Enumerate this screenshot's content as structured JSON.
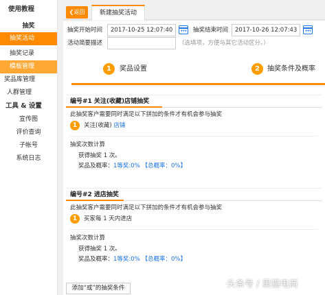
{
  "sidebar": {
    "group1": "使用教程",
    "sub1": "抽奖",
    "item_active": "抽奖活动",
    "item_record": "抽奖记录",
    "item_template": "模板管理",
    "item_prize_lib": "奖品库管理",
    "item_crowd": "人群管理",
    "group2": "工具 & 设置",
    "tools": [
      "宣传图",
      "评价查询",
      "子帐号",
      "系统日志"
    ]
  },
  "tabs": {
    "back": "返回",
    "current": "新建抽奖活动"
  },
  "form": {
    "start_label": "抽奖开始时间",
    "start_value": "2017-10-25 12:07:40",
    "end_label": "抽奖结束时间",
    "end_value": "2017-10-26 12:07:43",
    "desc_label": "活动简要描述",
    "desc_value": "",
    "desc_hint": "（选填项，方便与其它活动区分。）"
  },
  "steps": [
    {
      "num": "1",
      "label": "奖品设置"
    },
    {
      "num": "2",
      "label": "抽奖条件及概率"
    }
  ],
  "sections": [
    {
      "title": "编号#1 关注(收藏)店铺抽奖",
      "condition_intro": "此抽奖客户需要同时满足以下拼加的条件才有机会参与抽奖",
      "cond_num": "1",
      "cond_text": "关注(收藏)",
      "cond_link": "店铺",
      "count_heading": "抽奖次数计算",
      "gain_text": "获得抽奖 1 次。",
      "prob_label": "奖品及概率：",
      "prob_value": "1等奖:0%",
      "prob_total": "【总概率：0%】"
    },
    {
      "title": "编号#2 进店抽奖",
      "condition_intro": "此抽奖客户需要同时满足以下拼加的条件才有机会参与抽奖",
      "cond_num": "1",
      "cond_text": "买家每 1 天内进店",
      "cond_link": "",
      "count_heading": "抽奖次数计算",
      "gain_text": "获得抽奖 1 次。",
      "prob_label": "奖品及概率：",
      "prob_value": "1等奖:0%",
      "prob_total": "【总概率：0%】"
    }
  ],
  "add_button": "添加“或”的抽奖条件",
  "watermark": "头条号 / 黑猫电商",
  "colors": {
    "accent": "#ff8a00",
    "link": "#1a73e8"
  }
}
